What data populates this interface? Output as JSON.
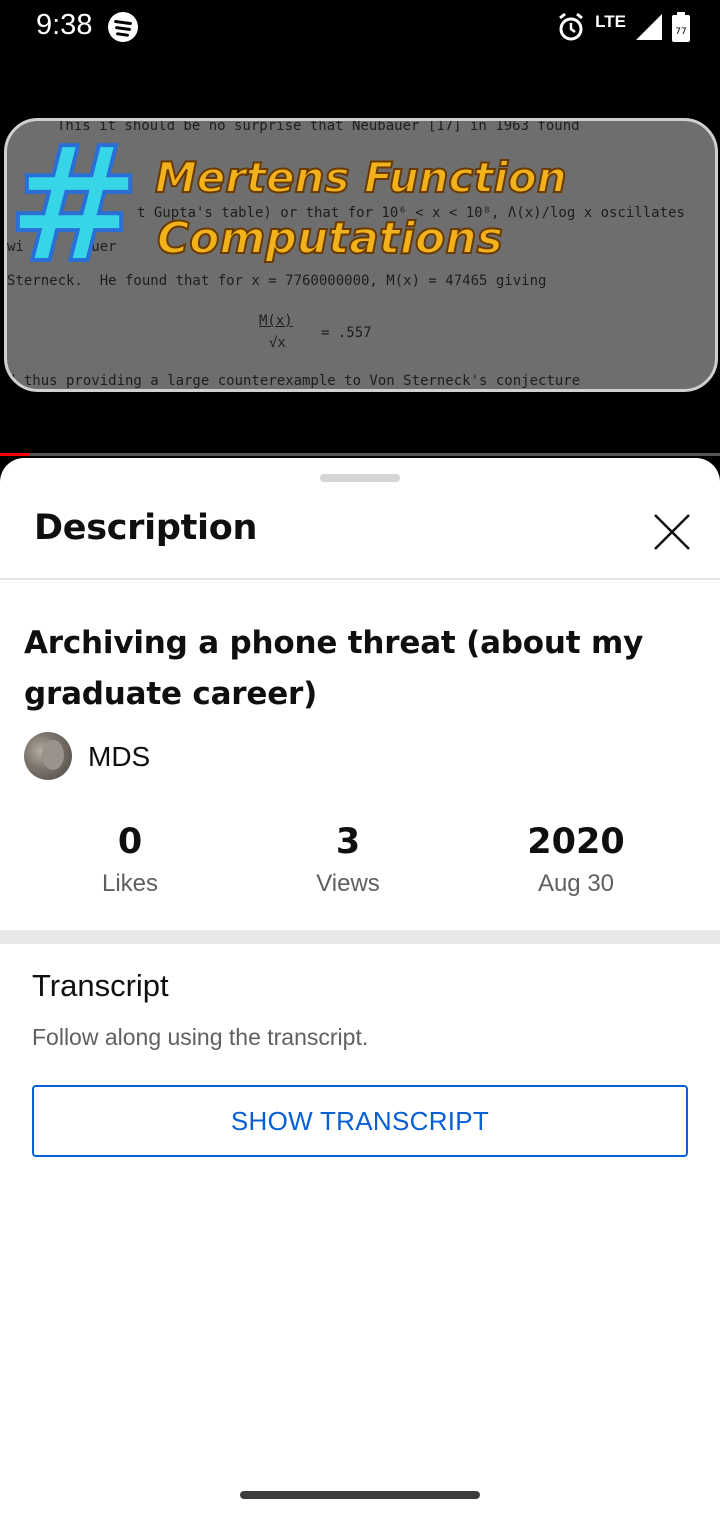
{
  "status_bar": {
    "time": "9:38",
    "network": "LTE",
    "battery": "77",
    "icons": [
      "spotify-icon",
      "alarm-icon",
      "signal-icon",
      "battery-icon"
    ]
  },
  "video": {
    "thumbnail_title_line1": "Mertens Function",
    "thumbnail_title_line2": "Computations",
    "thumbnail_symbol": "#",
    "thumbnail_text_lines": [
      "This it should be no surprise that Neubauer [17] in 1963 found",
      "t Gupta's table) or that for 10⁶ < x < 10⁸, Λ(x)/log x oscillates",
      "wi      bauer",
      "Sterneck.  He found that for x = 7760000000, M(x) = 47465 giving",
      "M(x)",
      "√x",
      "= .557",
      "d thus providing a large counterexample to Von Sterneck's conjecture"
    ],
    "progress_fraction": 0.04
  },
  "sheet": {
    "title": "Description",
    "close_icon": "close-icon"
  },
  "details": {
    "video_title": "Archiving a phone threat (about my graduate career)",
    "channel_name": "MDS",
    "stats": [
      {
        "value": "0",
        "label": "Likes"
      },
      {
        "value": "3",
        "label": "Views"
      },
      {
        "value": "2020",
        "label": "Aug 30"
      }
    ]
  },
  "transcript": {
    "heading": "Transcript",
    "subtitle": "Follow along using the transcript.",
    "button_label": "SHOW TRANSCRIPT"
  },
  "colors": {
    "accent": "#065fd4",
    "progress": "#ff0000",
    "thumbnail_text": "#f2b21c",
    "hash_symbol": "#36d6e8"
  }
}
